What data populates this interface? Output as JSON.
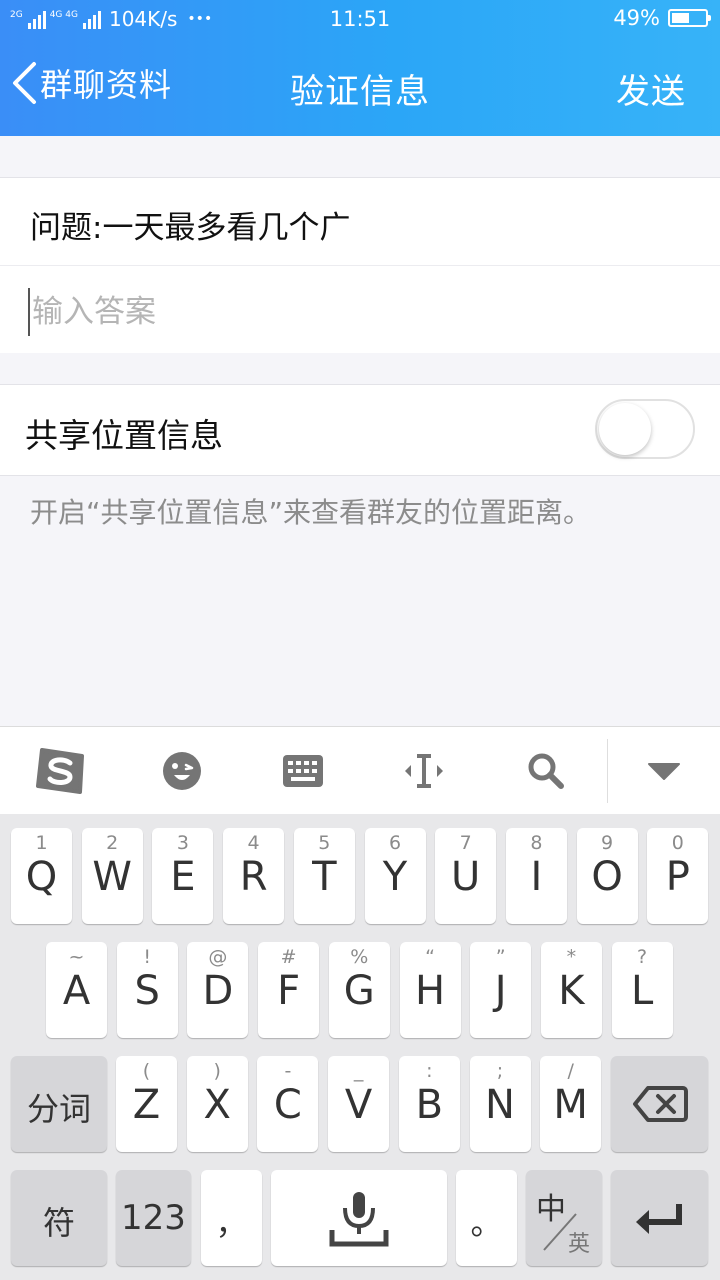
{
  "status_bar": {
    "net_label_1": "2G",
    "net_label_2": "4G 4G",
    "speed": "104K/s",
    "dots": "•••",
    "time": "11:51",
    "battery_percent": "49%",
    "battery_level": 0.49
  },
  "header": {
    "back_label": "群聊资料",
    "title": "验证信息",
    "send_label": "发送"
  },
  "question": {
    "label": "问题:一天最多看几个广",
    "answer_placeholder": "输入答案",
    "answer_value": ""
  },
  "share_location": {
    "label": "共享位置信息",
    "enabled": false,
    "hint": "开启“共享位置信息”来查看群友的位置距离。"
  },
  "keyboard": {
    "toolbar_icons": [
      "sogou-logo-icon",
      "emoji-icon",
      "keyboard-icon",
      "cursor-move-icon",
      "search-icon",
      "hide-keyboard-icon"
    ],
    "row1": [
      {
        "main": "Q",
        "sub": "1"
      },
      {
        "main": "W",
        "sub": "2"
      },
      {
        "main": "E",
        "sub": "3"
      },
      {
        "main": "R",
        "sub": "4"
      },
      {
        "main": "T",
        "sub": "5"
      },
      {
        "main": "Y",
        "sub": "6"
      },
      {
        "main": "U",
        "sub": "7"
      },
      {
        "main": "I",
        "sub": "8"
      },
      {
        "main": "O",
        "sub": "9"
      },
      {
        "main": "P",
        "sub": "0"
      }
    ],
    "row2": [
      {
        "main": "A",
        "sub": "~"
      },
      {
        "main": "S",
        "sub": "!"
      },
      {
        "main": "D",
        "sub": "@"
      },
      {
        "main": "F",
        "sub": "#"
      },
      {
        "main": "G",
        "sub": "%"
      },
      {
        "main": "H",
        "sub": "“"
      },
      {
        "main": "J",
        "sub": "”"
      },
      {
        "main": "K",
        "sub": "*"
      },
      {
        "main": "L",
        "sub": "?"
      }
    ],
    "row3": [
      {
        "main": "Z",
        "sub": "("
      },
      {
        "main": "X",
        "sub": ")"
      },
      {
        "main": "C",
        "sub": "-"
      },
      {
        "main": "V",
        "sub": "_"
      },
      {
        "main": "B",
        "sub": ":"
      },
      {
        "main": "N",
        "sub": ";"
      },
      {
        "main": "M",
        "sub": "/"
      }
    ],
    "segment_key": "分词",
    "symbol_key": "符",
    "numbers_key": "123",
    "comma_key": "，",
    "period_key": "。",
    "lang_key_top": "中",
    "lang_key_bottom": "英"
  }
}
